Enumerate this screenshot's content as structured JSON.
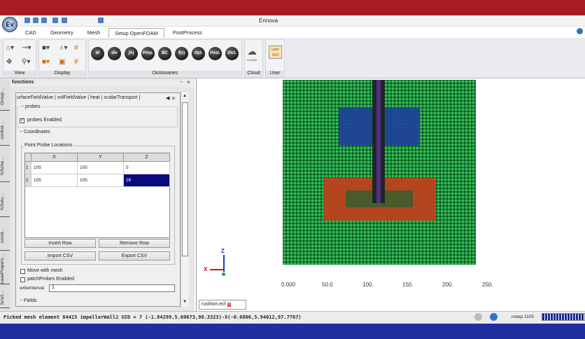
{
  "app": {
    "title": "Ennova",
    "logo": "Ev"
  },
  "menu_tabs": [
    "CAD",
    "Geometry",
    "Mesh",
    "Setup OpenFOAM",
    "PostProcess"
  ],
  "ribbon": {
    "groups": [
      "View",
      "Display",
      "Dictionaries",
      "Cloud",
      "User"
    ],
    "dictionary_buttons": [
      "dt",
      "div",
      "|A|",
      "Prop.",
      "BC",
      "f(x)",
      "Opt.",
      "Post.",
      "Dict."
    ],
    "cloud_label": "CLOUD",
    "user_label": "User GUI"
  },
  "side_tabs": [
    "Group…",
    "control…",
    "fvSche…",
    "fvSolu…",
    "const…",
    "casePropers…",
    "funct…"
  ],
  "panel": {
    "title": "functions",
    "func_tabs": [
      "urfaceFieldValue",
      "volFieldValue",
      "heat",
      "scalarTransport"
    ],
    "probes_section": "probes",
    "probes_enabled": "probes Enabled",
    "coordinates_section": "Coordinates",
    "point_probe_locations": "Point Probe Locations",
    "table": {
      "headers": [
        "X",
        "Y",
        "Z"
      ],
      "rows": [
        {
          "n": "1",
          "x": "105",
          "y": "105",
          "z": "5"
        },
        {
          "n": "2",
          "x": "105",
          "y": "105",
          "z": "26"
        }
      ]
    },
    "buttons": {
      "insert": "Insert Row",
      "remove": "Remove Row",
      "import": "Import CSV",
      "export": "Export CSV"
    },
    "move_with_mesh": "Move with mesh",
    "patch_probes": "patchProbes Enabled",
    "write_interval_label": "writeInterval",
    "write_interval_value": "1",
    "fields_section": "Fields"
  },
  "viewport": {
    "axis_ticks": [
      "0.000",
      "50.0",
      "100.",
      "150.",
      "200.",
      "250."
    ],
    "axis_z": "Z",
    "axis_x": "X",
    "doc_tab": "rushton.ecf"
  },
  "status": {
    "message": "Picked mesh element 84415 impellerWall2 UID = 7 (-1.84299,5.60673,90.3323)-X(-0.6806,5.94012,97.7767)",
    "notepad": "notep 1105"
  }
}
